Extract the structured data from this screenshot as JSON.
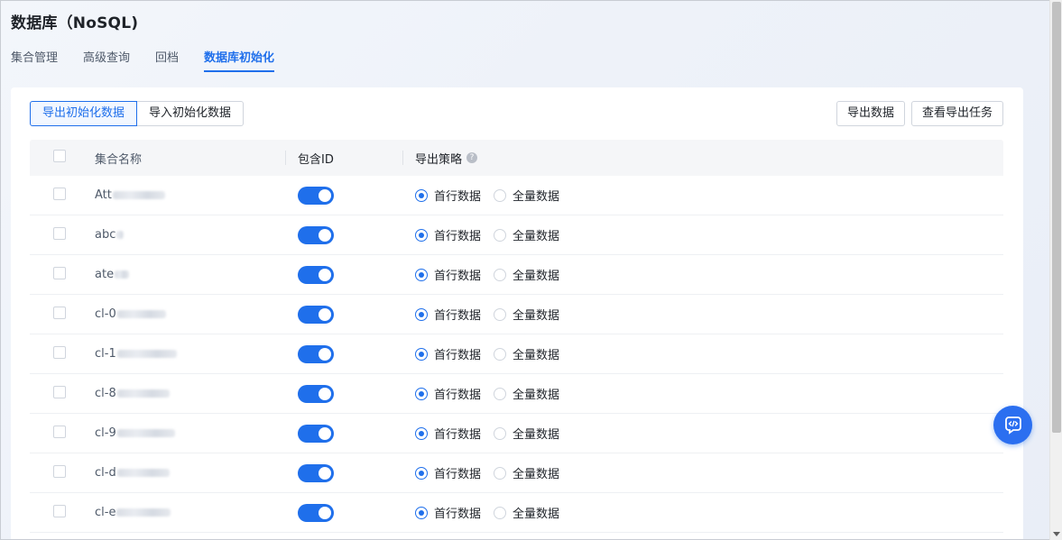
{
  "page": {
    "title": "数据库（NoSQL)"
  },
  "tabs": [
    {
      "label": "集合管理",
      "active": false
    },
    {
      "label": "高级查询",
      "active": false
    },
    {
      "label": "回档",
      "active": false
    },
    {
      "label": "数据库初始化",
      "active": true
    }
  ],
  "toolbar": {
    "segment": {
      "export_label": "导出初始化数据",
      "import_label": "导入初始化数据",
      "selected": "导出初始化数据"
    },
    "export_data_label": "导出数据",
    "view_export_tasks_label": "查看导出任务"
  },
  "table": {
    "headers": {
      "name": "集合名称",
      "include_id": "包含ID",
      "strategy": "导出策略"
    },
    "rows": [
      {
        "name": "Att",
        "include_id": true,
        "strategy": "首行数据"
      },
      {
        "name": "abc",
        "include_id": true,
        "strategy": "首行数据"
      },
      {
        "name": "ate",
        "include_id": true,
        "strategy": "首行数据"
      },
      {
        "name": "cl-0",
        "include_id": true,
        "strategy": "首行数据"
      },
      {
        "name": "cl-1",
        "include_id": true,
        "strategy": "首行数据"
      },
      {
        "name": "cl-8",
        "include_id": true,
        "strategy": "首行数据"
      },
      {
        "name": "cl-9",
        "include_id": true,
        "strategy": "首行数据"
      },
      {
        "name": "cl-d",
        "include_id": true,
        "strategy": "首行数据"
      },
      {
        "name": "cl-e",
        "include_id": true,
        "strategy": "首行数据"
      }
    ],
    "strategy_options": [
      "首行数据",
      "全量数据"
    ]
  },
  "icons": {
    "help": "question-circle-icon",
    "fab": "code-chat-icon"
  },
  "colors": {
    "accent": "#1f6feb"
  }
}
